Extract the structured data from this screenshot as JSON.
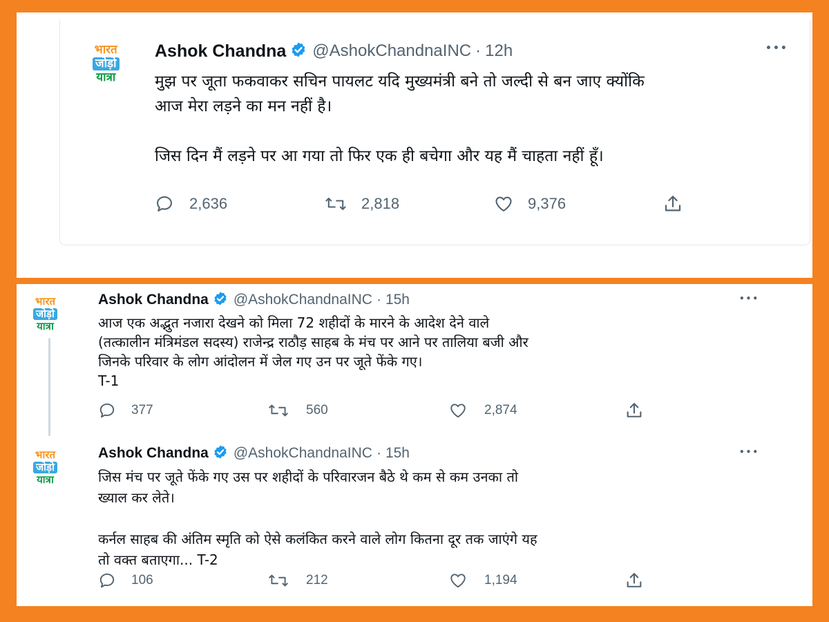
{
  "tweets": [
    {
      "author": {
        "name": "Ashok Chandna",
        "handle": "@AshokChandnaINC",
        "time": "12h"
      },
      "avatar_lines": [
        "भारत",
        "जोड़ो",
        "यात्रा"
      ],
      "text": "मुझ पर जूता फकवाकर सचिन पायलट यदि मुख्यमंत्री बने तो जल्दी से बन जाए क्योंकि\nआज मेरा लड़ने का मन नहीं है।\n\nजिस दिन मैं लड़ने पर आ गया तो फिर एक ही बचेगा और यह मैं चाहता नहीं हूँ।",
      "stats": {
        "replies": "2,636",
        "retweets": "2,818",
        "likes": "9,376"
      }
    },
    {
      "author": {
        "name": "Ashok Chandna",
        "handle": "@AshokChandnaINC",
        "time": "15h"
      },
      "avatar_lines": [
        "भारत",
        "जोड़ो",
        "यात्रा"
      ],
      "text": "आज एक अद्भुत नजारा देखने को मिला 72 शहीदों के मारने के आदेश देने वाले\n(तत्कालीन मंत्रिमंडल सदस्य) राजेन्द्र राठौड़ साहब के मंच पर आने पर तालिया बजी और\nजिनके परिवार के लोग आंदोलन में जेल गए उन पर जूते फेंके गए।\nT-1",
      "stats": {
        "replies": "377",
        "retweets": "560",
        "likes": "2,874"
      }
    },
    {
      "author": {
        "name": "Ashok Chandna",
        "handle": "@AshokChandnaINC",
        "time": "15h"
      },
      "avatar_lines": [
        "भारत",
        "जोड़ो",
        "यात्रा"
      ],
      "text": "जिस मंच पर जूते फेंके गए उस पर शहीदों के परिवारजन बैठे थे कम से कम उनका तो\nख्याल कर लेते।\n\nकर्नल साहब की अंतिम स्मृति को ऐसे कलंकित करने वाले लोग कितना दूर तक जाएंगे यह\nतो वक्त बताएगा... T-2",
      "stats": {
        "replies": "106",
        "retweets": "212",
        "likes": "1,194"
      }
    }
  ],
  "meta_separator": "·",
  "more_glyph": "•••",
  "colors": {
    "frame": "#f58220",
    "verified": "#1d9bf0",
    "muted": "#536471",
    "text": "#0f1419"
  },
  "icons": [
    "verified-badge-icon",
    "reply-icon",
    "retweet-icon",
    "like-icon",
    "share-icon",
    "more-options-icon"
  ]
}
